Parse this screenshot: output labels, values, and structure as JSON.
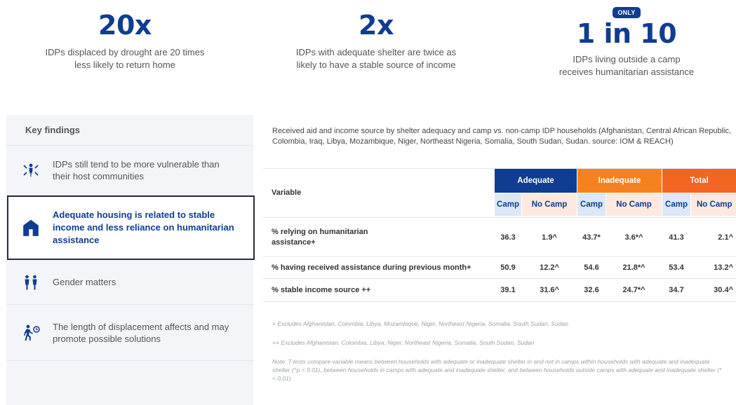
{
  "stats": [
    {
      "value": "20x",
      "description_line1": "IDPs displaced by drought are 20 times",
      "description_line2": "less likely to return home"
    },
    {
      "value": "2x",
      "description_line1": "IDPs with adequate shelter are twice as",
      "description_line2": "likely to have a stable source of income"
    },
    {
      "badge": "ONLY",
      "value": "1 in 10",
      "description_line1": "IDPs living outside a camp",
      "description_line2": "receives humanitarian assistance"
    }
  ],
  "sidebar": {
    "title": "Key findings",
    "items": [
      {
        "icon": "people-arrows-icon",
        "label": "IDPs still tend to be more vulnerable than their host communities"
      },
      {
        "icon": "house-icon",
        "label": "Adequate housing is related to stable income and less reliance on humanitarian assistance",
        "active": true
      },
      {
        "icon": "gender-icon",
        "label": "Gender matters"
      },
      {
        "icon": "walking-clock-icon",
        "label": "The length of displacement affects and may promote possible solutions"
      }
    ]
  },
  "content": {
    "caption": "Received aid and income source by shelter adequacy and camp vs. non-camp IDP households (Afghanistan, Central African Republic, Colombia, Iraq, Libya, Mozambique, Niger, Northeast Nigeria, Somalia, South Sudan, Sudan. source: IOM & REACH)",
    "table": {
      "variable_header": "Variable",
      "groups": [
        "Adequate",
        "Inadequate",
        "Total"
      ],
      "subheaders": [
        "Camp",
        "No Camp",
        "Camp",
        "No Camp",
        "Camp",
        "No Camp"
      ],
      "rows": [
        {
          "variable": "% relying on humanitarian assistance+",
          "values": [
            "36.3",
            "1.9^",
            "43.7*",
            "3.6*^",
            "41.3",
            "2.1^"
          ]
        },
        {
          "variable": "% having received assistance during previous month+",
          "values": [
            "50.9",
            "12.2^",
            "54.6",
            "21.8*^",
            "53.4",
            "13.2^"
          ]
        },
        {
          "variable": "% stable income source ++",
          "values": [
            "39.1",
            "31.6^",
            "32.6",
            "24.7*^",
            "34.7",
            "30.4^"
          ]
        }
      ]
    },
    "notes": [
      "+ Excludes Afghanistan, Colombia, Libya, Mozambique, Niger, Northeast Nigeria, Somalia, South Sudan, Sudan.",
      "++ Excludes Afghanistan, Colombia, Libya, Niger, Northeast Nigeria, Somalia, South Sudan, Sudan",
      "Note: T-tests compare variable means between households with adequate or inadequate shelter in and not in camps within households with adequate and inadequate shelter (^p < 0.01), between households in camps with adequate and inadequate shelter, and between households outside camps with adequate and inadequate shelter (* < 0.01)"
    ]
  },
  "colors": {
    "brand_blue": "#0f3d91",
    "orange": "#f6821f",
    "orange_dark": "#f26522"
  }
}
